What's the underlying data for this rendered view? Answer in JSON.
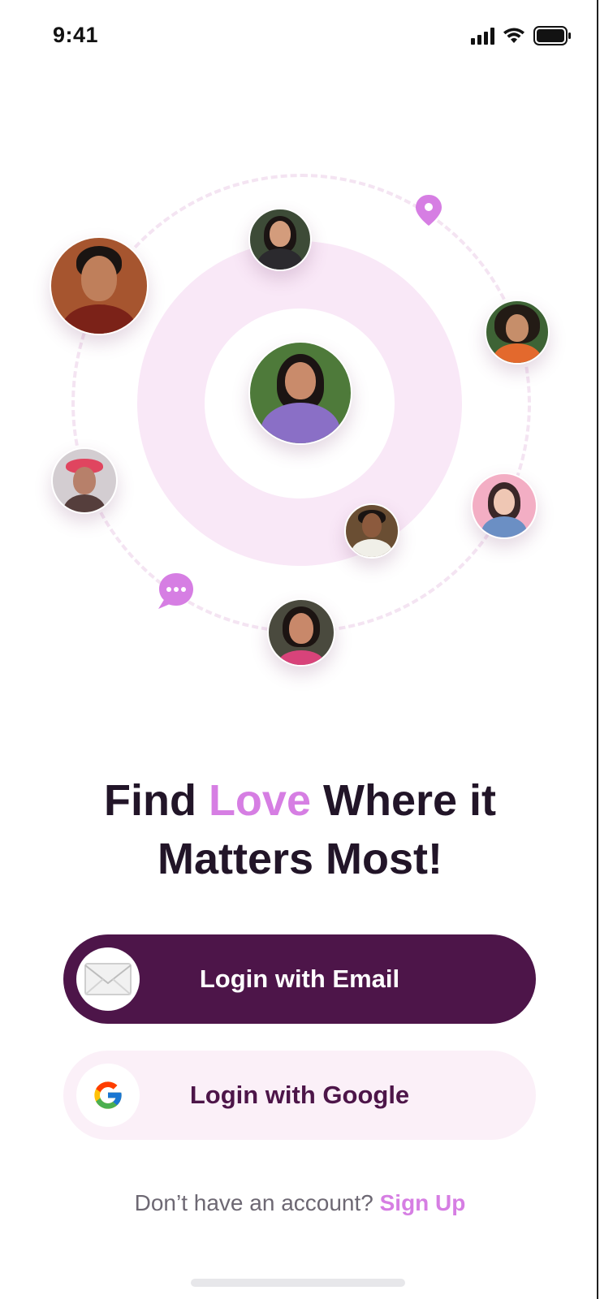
{
  "status_bar": {
    "time": "9:41",
    "icons": [
      "cellular-signal-icon",
      "wifi-icon",
      "battery-icon"
    ]
  },
  "illustration": {
    "icons": [
      "location-pin-icon",
      "chat-bubble-icon"
    ],
    "colors": {
      "ring": "#f9e8f7",
      "dashed_orbit": "#f4e4f2",
      "accent": "#d67ee3"
    }
  },
  "headline": {
    "line1_before": "Find ",
    "line1_accent": "Love",
    "line1_after": " Where it",
    "line2": "Matters Most!"
  },
  "buttons": {
    "email": {
      "label": "Login with Email",
      "icon": "envelope-icon",
      "color": "#4d1549"
    },
    "google": {
      "label": "Login with Google",
      "icon": "google-logo-icon",
      "color": "#fbf0f8"
    }
  },
  "footer": {
    "prompt": "Don’t have an account?",
    "signup_label": "Sign Up"
  }
}
